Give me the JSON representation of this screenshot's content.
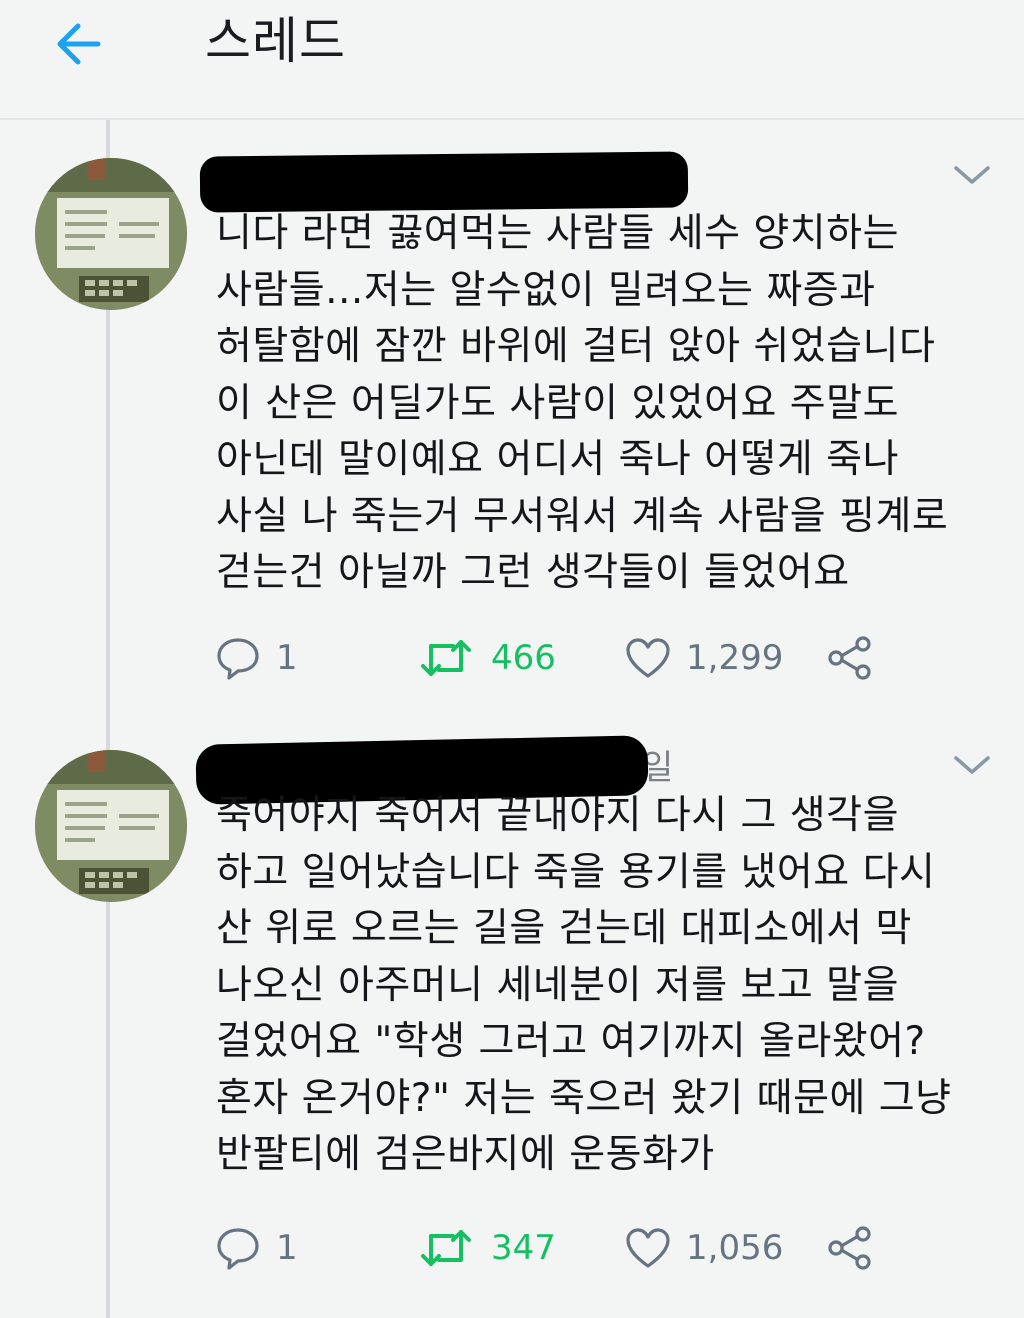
{
  "header": {
    "title": "스레드",
    "back_icon": "arrow-left-icon"
  },
  "colors": {
    "accent": "#1da1f2",
    "retweet": "#17bf63",
    "muted": "#667380",
    "background": "#f3f4f4"
  },
  "tweets": [
    {
      "author_redacted": true,
      "time_suffix": "",
      "lines": [
        "니다 라면 끓여먹는 사람들 세수 양치하는",
        "사람들...저는 알수없이 밀려오는 짜증과",
        "허탈함에 잠깐 바위에 걸터 앉아 쉬었습니다",
        "이 산은 어딜가도 사람이 있었어요 주말도",
        "아닌데 말이예요 어디서 죽나 어떻게 죽나",
        "사실 나 죽는거 무서워서 계속 사람을 핑계로",
        "걷는건 아닐까 그런 생각들이 들었어요"
      ],
      "replies": "1",
      "retweets": "466",
      "likes": "1,299"
    },
    {
      "author_redacted": true,
      "time_suffix": "일",
      "lines": [
        "죽어야지 죽어서 끝내야지 다시 그 생각을",
        "하고 일어났습니다 죽을 용기를 냈어요 다시",
        "산 위로 오르는 길을 걷는데 대피소에서 막",
        "나오신 아주머니 세네분이 저를 보고 말을",
        "걸었어요 \"학생 그러고 여기까지 올라왔어?",
        "혼자 온거야?\" 저는 죽으러 왔기 때문에 그냥",
        "반팔티에 검은바지에 운동화가"
      ],
      "replies": "1",
      "retweets": "347",
      "likes": "1,056"
    }
  ]
}
